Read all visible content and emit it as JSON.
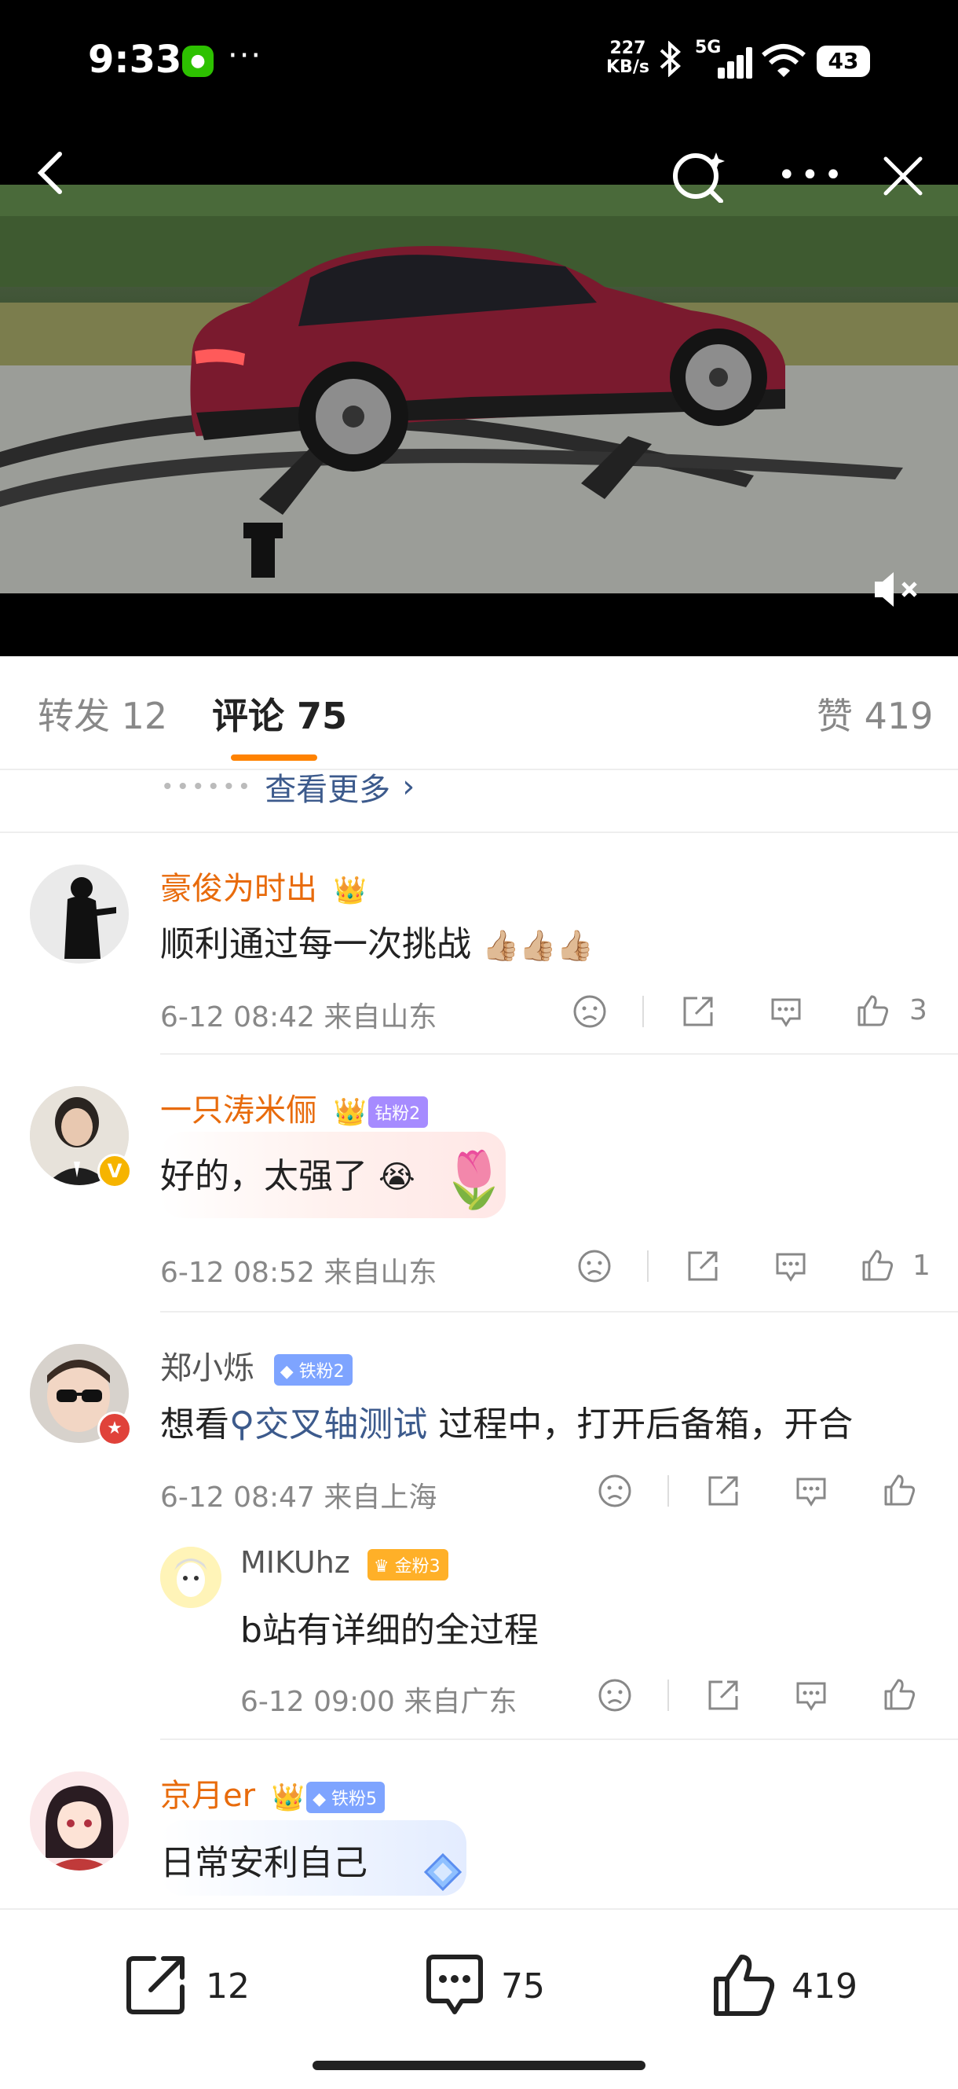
{
  "status_bar": {
    "time": "9:33",
    "net_speed_value": "227",
    "net_speed_unit": "KB/s",
    "network": "5G",
    "battery": "43",
    "icons": [
      "wechat-icon",
      "bluetooth-icon",
      "signal-icon",
      "wifi-icon",
      "battery-icon"
    ]
  },
  "nav": {
    "icons": [
      "back-icon",
      "search-icon",
      "more-icon",
      "close-icon"
    ]
  },
  "tabs": {
    "repost_label": "转发 12",
    "comment_label": "评论 75",
    "like_label": "赞 419",
    "active": "comment"
  },
  "view_more": "查看更多",
  "comments": [
    {
      "username": "豪俊为时出",
      "text": "顺利通过每一次挑战",
      "emoji": "👍🏼👍🏼👍🏼",
      "meta": "6-12 08:42  来自山东",
      "likes": "3"
    },
    {
      "username": "一只涛米俪",
      "badge": "钻粉2",
      "text": "好的，太强了",
      "emoji": "😭",
      "meta": "6-12 08:52  来自山东",
      "likes": "1"
    },
    {
      "username": "郑小烁",
      "badge": "铁粉2",
      "text_before": "想看",
      "topic": "交叉轴测试",
      "text_after": " 过程中，打开后备箱，开合",
      "meta": "6-12 08:47  来自上海",
      "reply": {
        "username": "MIKUhz",
        "badge": "金粉3",
        "text": "b站有详细的全过程",
        "meta": "6-12 09:00  来自广东"
      }
    },
    {
      "username": "京月er",
      "badge": "铁粉5",
      "text": "日常安利自己"
    }
  ],
  "bottom_bar": {
    "repost_count": "12",
    "comment_count": "75",
    "like_count": "419"
  },
  "colors": {
    "accent": "#ff8200",
    "username": "#e86b0c",
    "link": "#3c5a8c",
    "diamond_badge": "#a68bff",
    "iron_badge": "#7ea4ff",
    "gold_badge": "#ffb028"
  }
}
